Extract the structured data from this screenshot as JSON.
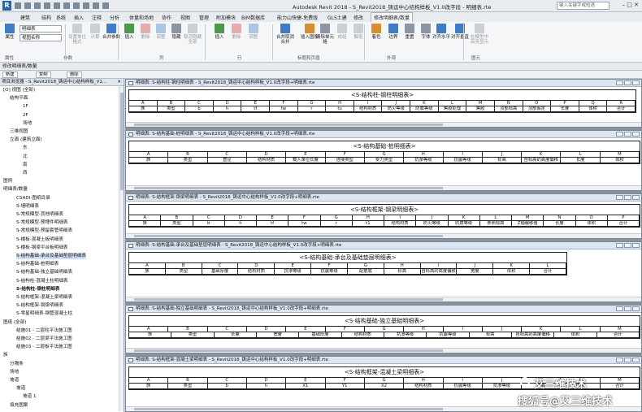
{
  "app": {
    "title": "Autodesk Revit 2018 -   S_Revit2018_铸运中心结构样板_V1.0改字段 - 明细表.rte",
    "search_placeholder": "键入关键字或短语"
  },
  "ribbon_tabs": [
    "建筑",
    "结构",
    "系统",
    "插入",
    "注释",
    "分析",
    "体量和场地",
    "协作",
    "视图",
    "管理",
    "附加模块",
    "BIM数据库",
    "能力山快捷-免费版",
    "GLS土建",
    "修改",
    "修改明细表/数量"
  ],
  "ribbon": {
    "properties_label": "属性",
    "combo1": "明细表",
    "combo2": "视图名称",
    "buttons": [
      "设置单位格式",
      "计算",
      "合并参数",
      "插入",
      "删除",
      "调整",
      "隐藏",
      "取消隐藏全部",
      "插入",
      "删除",
      "调整",
      "合并取消合并",
      "插入图像",
      "清除单元格",
      "成组",
      "解组",
      "着色",
      "边界",
      "重置",
      "字体",
      "对齐水平",
      "对齐垂直",
      "在模型中高亮显示"
    ],
    "groups": [
      "属性",
      "参数",
      "列",
      "行",
      "标题和页眉",
      "外观",
      "图元"
    ]
  },
  "context_bar": "修改明细表/数量",
  "option_bar": [
    "新建",
    "复制",
    "删除"
  ],
  "browser": {
    "title": "项目浏览器 - S_Revit2018_铸运中心结构样板_V1...",
    "items": [
      {
        "t": "[O] 视图 (全部)",
        "l": 0,
        "b": false
      },
      {
        "t": "结构平面",
        "l": 1,
        "b": false
      },
      {
        "t": "1F",
        "l": 3,
        "b": false
      },
      {
        "t": "2F",
        "l": 3,
        "b": false
      },
      {
        "t": "场地",
        "l": 3,
        "b": false
      },
      {
        "t": "三维视图",
        "l": 1,
        "b": false
      },
      {
        "t": "立面 (建筑立面)",
        "l": 1,
        "b": false
      },
      {
        "t": "东",
        "l": 3,
        "b": false
      },
      {
        "t": "北",
        "l": 3,
        "b": false
      },
      {
        "t": "南",
        "l": 3,
        "b": false
      },
      {
        "t": "西",
        "l": 3,
        "b": false
      },
      {
        "t": "图例",
        "l": 0,
        "b": false
      },
      {
        "t": "明细表/数量",
        "l": 0,
        "b": false
      },
      {
        "t": "CSADI-图纸目录",
        "l": 2,
        "b": false
      },
      {
        "t": "S-墙明细表",
        "l": 2,
        "b": false
      },
      {
        "t": "S-常规模型-其他明细表",
        "l": 2,
        "b": false
      },
      {
        "t": "S-常规模型-预埋件明细表",
        "l": 2,
        "b": false
      },
      {
        "t": "S-常规模型-预留套管明细表",
        "l": 2,
        "b": false
      },
      {
        "t": "S-楼板-混凝土板明细表",
        "l": 2,
        "b": false
      },
      {
        "t": "S-楼板-钢梁平台板明细表",
        "l": 2,
        "b": false
      },
      {
        "t": "S-结构基础-承台及基础垫层明细表",
        "l": 2,
        "b": false,
        "sel": true
      },
      {
        "t": "S-结构基础-桩明细表",
        "l": 2,
        "b": false
      },
      {
        "t": "S-结构基础-独立基础明细表",
        "l": 2,
        "b": false
      },
      {
        "t": "S-结构柱-混凝土柱明细表",
        "l": 2,
        "b": false
      },
      {
        "t": "S-结构柱-钢柱明细表",
        "l": 2,
        "b": true
      },
      {
        "t": "S-结构框架-混凝土梁明细表",
        "l": 2,
        "b": false
      },
      {
        "t": "S-结构框架-钢梁明细表",
        "l": 2,
        "b": false
      },
      {
        "t": "S-零星明细表-钢管混凝土柱",
        "l": 2,
        "b": false
      },
      {
        "t": "图纸 (全部)",
        "l": 0,
        "b": false
      },
      {
        "t": "结施01 - 二层柱平法施工图",
        "l": 2,
        "b": false
      },
      {
        "t": "结施02 - 二层梁平法施工图",
        "l": 2,
        "b": false
      },
      {
        "t": "结施03 - 二层板平法施工图",
        "l": 2,
        "b": false
      },
      {
        "t": "族",
        "l": 0,
        "b": false
      },
      {
        "t": "分隔条",
        "l": 1,
        "b": false
      },
      {
        "t": "场地",
        "l": 1,
        "b": false
      },
      {
        "t": "坡道",
        "l": 1,
        "b": false
      },
      {
        "t": "坡道",
        "l": 2,
        "b": false
      },
      {
        "t": "坡道 1",
        "l": 3,
        "b": false
      },
      {
        "t": "填充图案",
        "l": 1,
        "b": false
      }
    ]
  },
  "windows": [
    {
      "title": "明细表: S-结构柱-钢柱明细表 - S_Revit2018_铸运中心结构样板_V1.0改字段+明细表.rte",
      "heading": "<S-结构柱-钢柱明细表>",
      "letters": [
        "A",
        "B",
        "C",
        "D",
        "E",
        "F",
        "G",
        "H",
        "I",
        "J",
        "K",
        "L",
        "M",
        "N",
        "O",
        "P",
        "Q",
        "R"
      ],
      "heads": [
        "族",
        "类型",
        "b",
        "h",
        "tf",
        "tw",
        "r",
        "tu",
        "结构材质",
        "防火等级",
        "防腐等级",
        "焦胶处理",
        "焦胶",
        "顶部标高",
        "顶部假定",
        "长度",
        "体积",
        "合计"
      ]
    },
    {
      "title": "明细表: S-结构基础-桩明细表 - S_Revit2018_铸运中心结构样板_V1.0改字段+明细表.rte",
      "heading": "<S-结构基础-桩明细表>",
      "letters": [
        "A",
        "B",
        "C",
        "D",
        "E",
        "F",
        "G",
        "H",
        "I",
        "J",
        "K",
        "L",
        "M"
      ],
      "heads": [
        "族",
        "类型",
        "直径",
        "结构材质",
        "载入单位长度",
        "连接类型",
        "受力类型",
        "抗渗等级",
        "抗震等级",
        "标高",
        "自标高的高度偏移",
        "长度",
        "体积"
      ]
    },
    {
      "title": "明细表: S-结构框架-钢梁明细表 - S_Revit2018_铸运中心结构样板_V1.0改字段+明细表.rte",
      "heading": "<S-结构框架-钢梁明细表>",
      "letters": [
        "A",
        "B",
        "C",
        "D",
        "E",
        "F",
        "G",
        "H",
        "I",
        "J",
        "K",
        "L",
        "M",
        "N",
        "O",
        "P"
      ],
      "heads": [
        "族",
        "类型",
        "b",
        "h",
        "tf",
        "tw",
        "r",
        "t1",
        "结构材质",
        "防火等级",
        "防腐等级",
        "参照标高",
        "Z轴偏移值",
        "长度",
        "体积",
        "合计"
      ]
    },
    {
      "title": "明细表: S-结构基础-承台及基础垫层明细表 - S_Revit2018_铸运中心结构样板_V1.0改字段+明细表.rte",
      "heading": "<S-结构基础-承台及基础垫层明细表>",
      "letters": [
        "A",
        "B",
        "C",
        "D",
        "E",
        "F",
        "G",
        "H",
        "I",
        "J",
        "K",
        "L"
      ],
      "heads": [
        "族",
        "类型",
        "基础厚度",
        "结构材质",
        "抗渗等级",
        "抗震等级",
        "配筋底",
        "标高",
        "自标高的高度偏移",
        "宽度",
        "体积",
        "合计"
      ]
    },
    {
      "title": "明细表: S-结构基础-独立基础明细表 - S_Revit2018_铸运中心结构样板_V1.0改字段+明细表.rte",
      "heading": "<S-结构基础-独立基础明细表>",
      "letters": [
        "A",
        "B",
        "C",
        "D",
        "E",
        "F",
        "G",
        "H",
        "I",
        "J",
        "K",
        "L",
        "M"
      ],
      "heads": [
        "族",
        "类型",
        "长度",
        "宽度",
        "基础厚度",
        "结构材质",
        "抗渗等级",
        "抗震等级",
        "标高",
        "自标高的高度偏移",
        "体积",
        "合计"
      ]
    },
    {
      "title": "明细表: S-结构框架-混凝土梁明细表 - S_Revit2018_铸运中心结构样板_V1.0改字段+明细表.rte",
      "heading": "<S-结构框架-混凝土梁明细表>",
      "letters": [
        "A",
        "B",
        "C",
        "D",
        "E",
        "F",
        "G",
        "H",
        "I",
        "J",
        "K",
        "L",
        "M"
      ],
      "heads": [
        "族",
        "类型",
        "b",
        "h",
        "X1",
        "Y1",
        "X2",
        "结构材质",
        "抗震等级",
        "抗渗等级",
        "标高",
        "体积",
        "合计"
      ]
    }
  ],
  "watermark": {
    "line1": "艾三维技术",
    "line2": "搜狐号@艾三维技术"
  }
}
